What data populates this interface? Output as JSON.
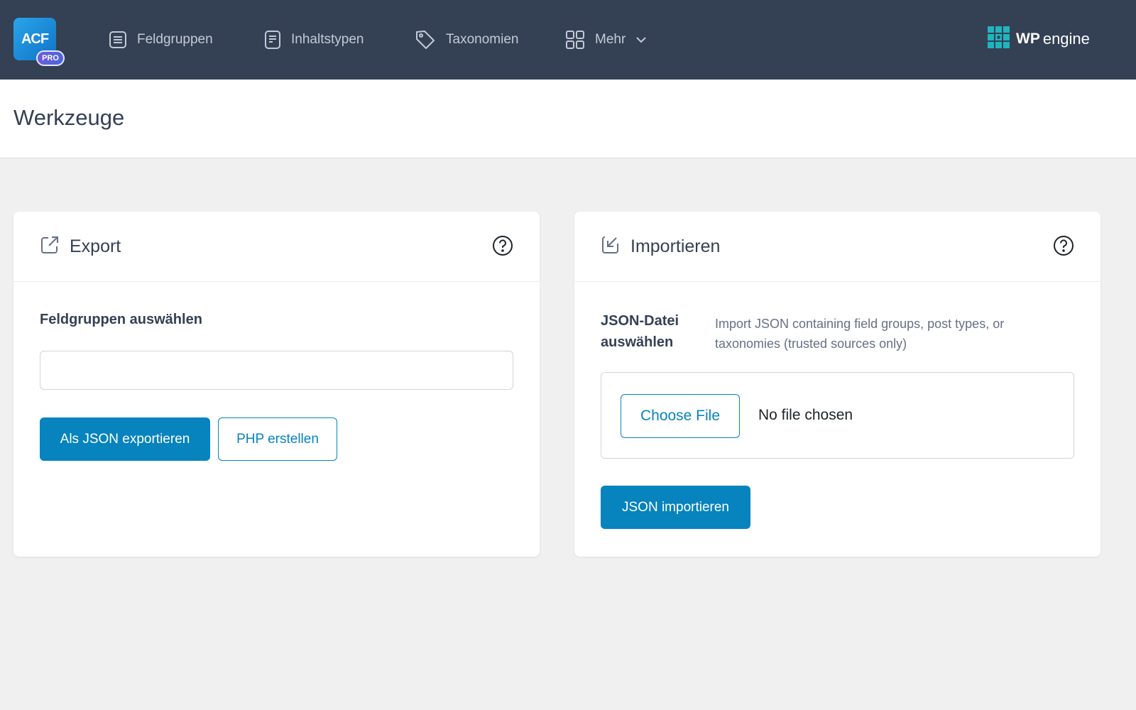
{
  "nav": {
    "logo_text": "ACF",
    "logo_badge": "PRO",
    "items": [
      {
        "label": "Feldgruppen",
        "icon": "field-groups-icon"
      },
      {
        "label": "Inhaltstypen",
        "icon": "post-types-icon"
      },
      {
        "label": "Taxonomien",
        "icon": "tag-icon"
      },
      {
        "label": "Mehr",
        "icon": "grid-icon"
      }
    ],
    "brand_wp": "WP",
    "brand_engine": "engine"
  },
  "header": {
    "title": "Werkzeuge"
  },
  "export": {
    "title": "Export",
    "field_label": "Feldgruppen auswählen",
    "input_value": "",
    "export_json_label": "Als JSON exportieren",
    "generate_php_label": "PHP erstellen"
  },
  "import": {
    "title": "Importieren",
    "field_label": "JSON-Datei auswählen",
    "description": "Import JSON containing field groups, post types, or taxonomies (trusted sources only)",
    "choose_file_label": "Choose File",
    "file_status": "No file chosen",
    "import_json_label": "JSON importieren"
  },
  "colors": {
    "topbar": "#344054",
    "primary": "#0783be",
    "page_bg": "#f0f0f1",
    "brand_accent": "#1fb5be"
  }
}
